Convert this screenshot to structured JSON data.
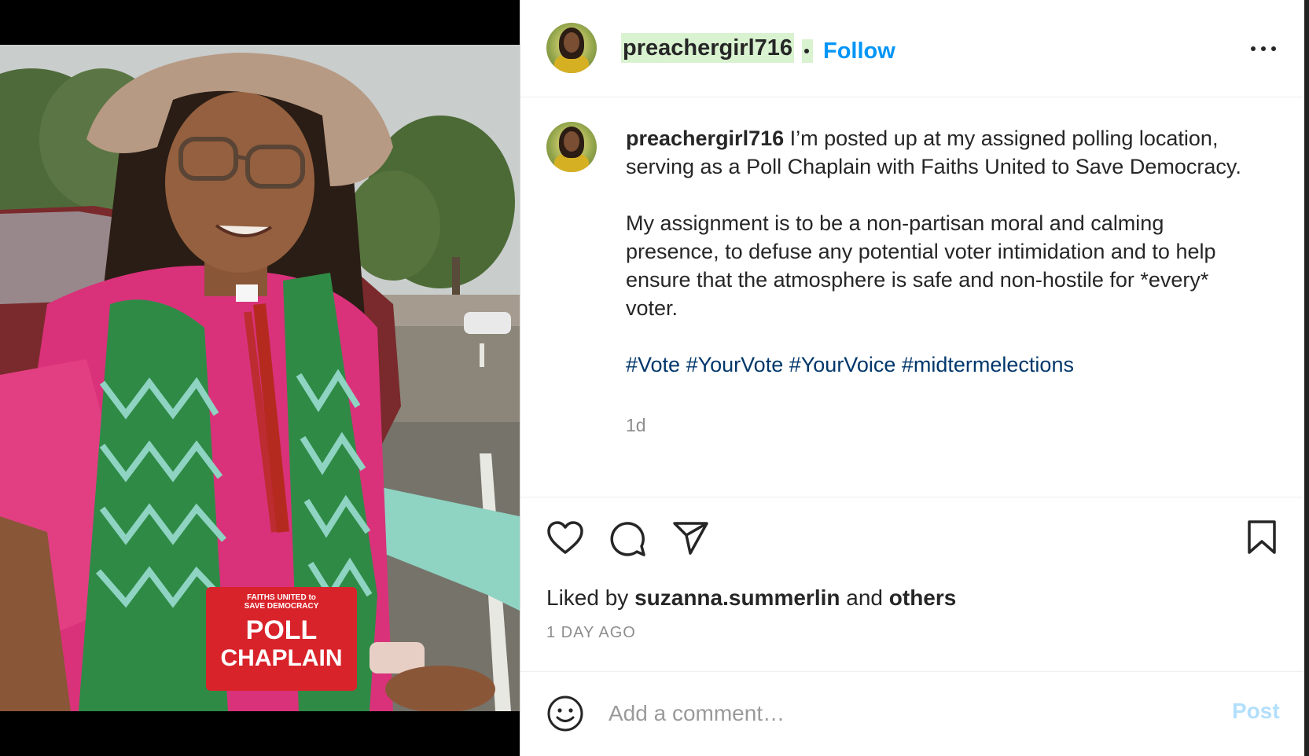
{
  "post": {
    "username": "preachergirl716",
    "follow_label": "Follow",
    "caption_line1": "I’m posted up at my assigned polling location, serving as a Poll Chaplain with Faiths United to Save Democracy.",
    "caption_line2": "My assignment is to be a non-partisan moral and calming presence, to defuse any potential voter intimidation and to help ensure that the atmosphere is safe and non-hostile for *every* voter.",
    "hashtags": [
      "#Vote",
      "#YourVote",
      "#YourVoice",
      "#midtermelections"
    ],
    "relative_time": "1d",
    "liked_by_prefix": "Liked by",
    "liked_by_user": "suzanna.summerlin",
    "liked_by_and": "and",
    "liked_by_others": "others",
    "posted_ago": "1 DAY AGO"
  },
  "photo": {
    "badge_org_line1": "FAITHS UNITED to",
    "badge_org_line2": "SAVE DEMOCRACY",
    "badge_line1": "POLL",
    "badge_line2": "CHAPLAIN"
  },
  "actions": {
    "like_icon": "heart-icon",
    "comment_icon": "comment-icon",
    "share_icon": "paper-plane-icon",
    "save_icon": "bookmark-icon",
    "more_icon": "more-horizontal-icon"
  },
  "comment_box": {
    "placeholder": "Add a comment…",
    "post_label": "Post",
    "emoji_icon": "smiley-icon"
  },
  "colors": {
    "link_blue": "#0095f6",
    "hashtag_blue": "#00376b",
    "username_highlight": "#d9f2d0",
    "post_disabled": "#b2dffc"
  }
}
